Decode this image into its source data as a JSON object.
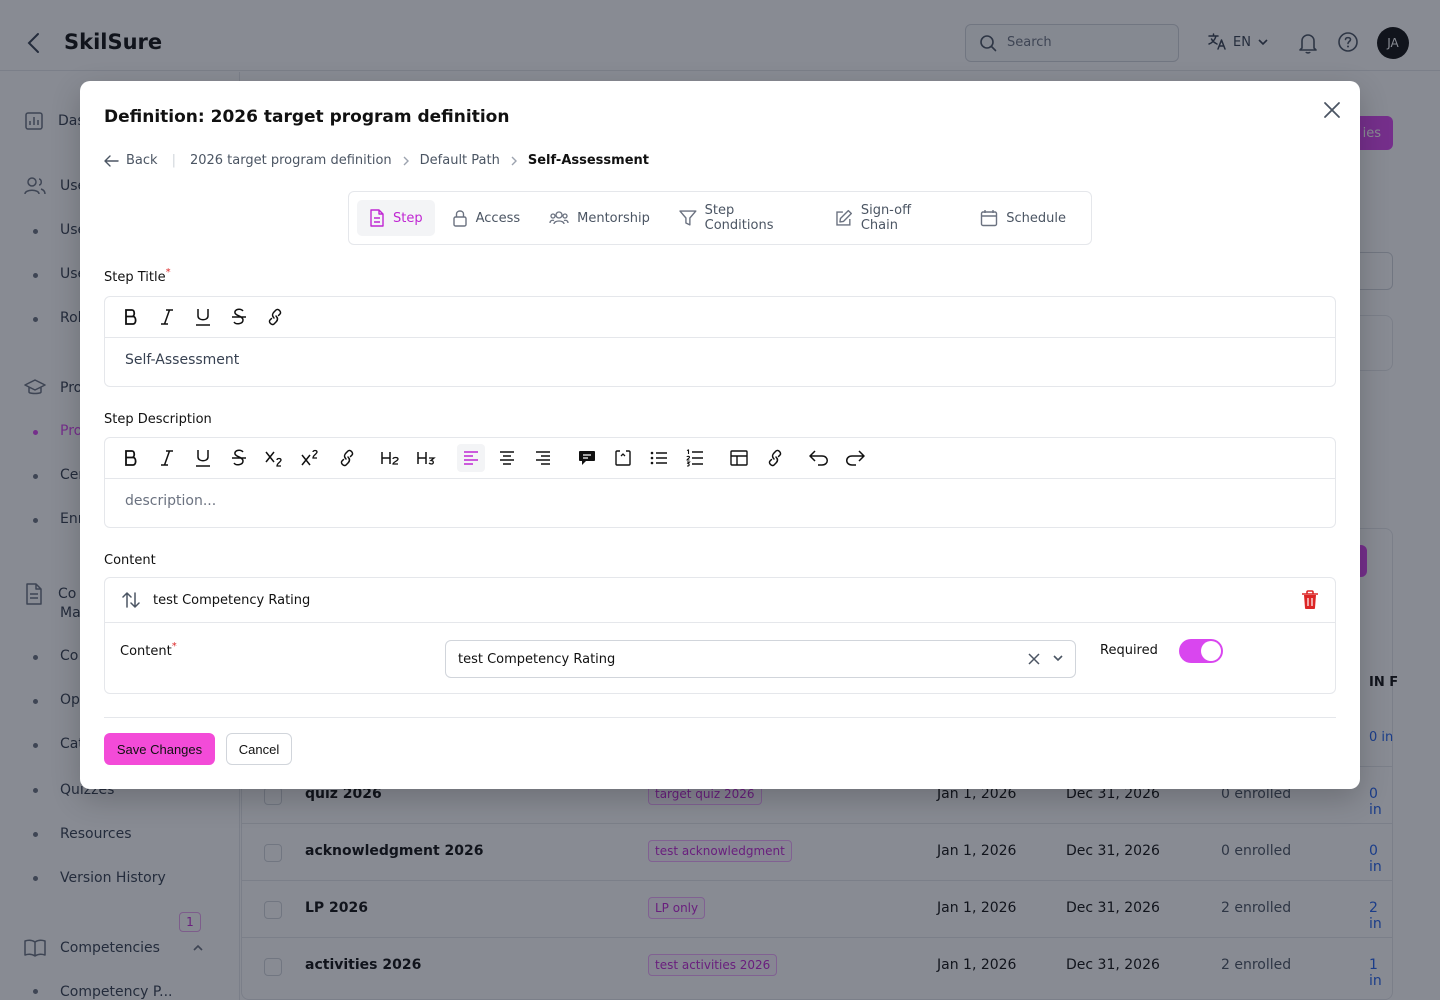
{
  "app": {
    "brand": "SkilSure",
    "search_placeholder": "Search",
    "language": "EN",
    "avatar_initials": "JA"
  },
  "sidebar": {
    "groups": [
      {
        "label": "Das"
      },
      {
        "label": "Use"
      },
      {
        "label": "Pro"
      },
      {
        "label": "Co"
      },
      {
        "label": "Competencies"
      }
    ],
    "group_3_second_line": "Ma",
    "items": [
      {
        "label": "Use"
      },
      {
        "label": "Use"
      },
      {
        "label": "Rol"
      },
      {
        "label": "Pro",
        "active": true
      },
      {
        "label": "Cer"
      },
      {
        "label": "Enr"
      },
      {
        "label": "Co"
      },
      {
        "label": "Opt"
      },
      {
        "label": "Cat"
      },
      {
        "label": "Quizzes"
      },
      {
        "label": "Resources"
      },
      {
        "label": "Version History"
      },
      {
        "label": "Competency P..."
      }
    ],
    "competency_badge": "1"
  },
  "background": {
    "top_button_label": "ies",
    "table_header_partial": "IN F",
    "first_row_inprogress": "0 in",
    "rows": [
      {
        "name": "quiz 2026",
        "tag": "target quiz 2026",
        "start": "Jan 1, 2026",
        "end": "Dec 31, 2026",
        "enrolled": "0 enrolled",
        "in_progress": "0 in"
      },
      {
        "name": "acknowledgment 2026",
        "tag": "test acknowledgment",
        "start": "Jan 1, 2026",
        "end": "Dec 31, 2026",
        "enrolled": "0 enrolled",
        "in_progress": "0 in"
      },
      {
        "name": "LP 2026",
        "tag": "LP only",
        "start": "Jan 1, 2026",
        "end": "Dec 31, 2026",
        "enrolled": "2 enrolled",
        "in_progress": "2 in"
      },
      {
        "name": "activities 2026",
        "tag": "test activities 2026",
        "start": "Jan 1, 2026",
        "end": "Dec 31, 2026",
        "enrolled": "2 enrolled",
        "in_progress": "1 in"
      }
    ]
  },
  "modal": {
    "title": "Definition: 2026 target program definition",
    "breadcrumb": {
      "back": "Back",
      "items": [
        "2026 target program definition",
        "Default Path"
      ],
      "current": "Self-Assessment"
    },
    "tabs": [
      {
        "label": "Step",
        "icon": "document-icon",
        "active": true
      },
      {
        "label": "Access",
        "icon": "lock-icon"
      },
      {
        "label": "Mentorship",
        "icon": "users-icon"
      },
      {
        "label": "Step Conditions",
        "icon": "filter-icon"
      },
      {
        "label": "Sign-off Chain",
        "icon": "pencil-square-icon"
      },
      {
        "label": "Schedule",
        "icon": "calendar-icon"
      }
    ],
    "step_title": {
      "label": "Step Title",
      "required_mark": "*",
      "value": "Self-Assessment"
    },
    "step_description": {
      "label": "Step Description",
      "placeholder": "description..."
    },
    "content_section": {
      "label": "Content",
      "item_title": "test Competency Rating",
      "field_label": "Content",
      "required_mark": "*",
      "selected_value": "test Competency Rating",
      "required_label": "Required",
      "required_on": true
    },
    "actions": {
      "save": "Save Changes",
      "cancel": "Cancel"
    },
    "colors": {
      "accent": "#d946ef",
      "save_button": "#f34bd8",
      "danger": "#dc2626"
    }
  }
}
